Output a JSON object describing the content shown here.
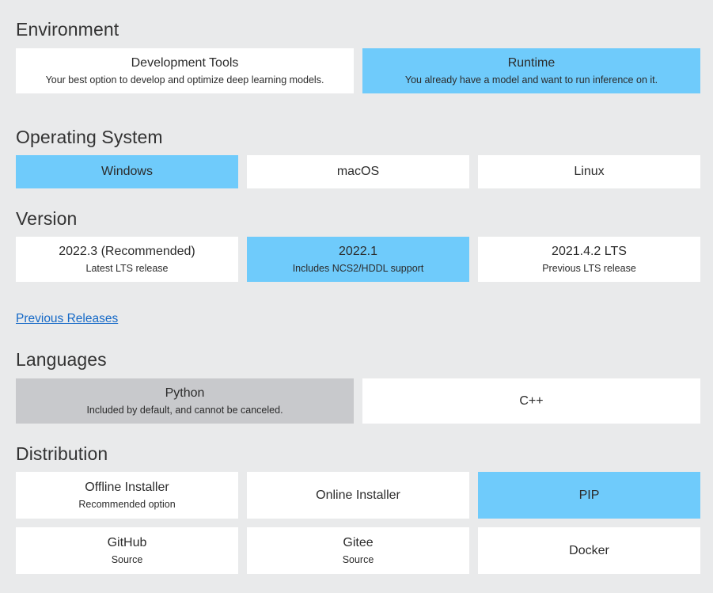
{
  "sections": {
    "environment": {
      "title": "Environment",
      "options": [
        {
          "title": "Development Tools",
          "subtitle": "Your best option to develop and optimize deep learning models.",
          "state": "default"
        },
        {
          "title": "Runtime",
          "subtitle": "You already have a model and want to run inference on it.",
          "state": "selected"
        }
      ]
    },
    "operating_system": {
      "title": "Operating System",
      "options": [
        {
          "title": "Windows",
          "subtitle": "",
          "state": "selected"
        },
        {
          "title": "macOS",
          "subtitle": "",
          "state": "default"
        },
        {
          "title": "Linux",
          "subtitle": "",
          "state": "default"
        }
      ]
    },
    "version": {
      "title": "Version",
      "options": [
        {
          "title": "2022.3 (Recommended)",
          "subtitle": "Latest LTS release",
          "state": "default"
        },
        {
          "title": "2022.1",
          "subtitle": "Includes NCS2/HDDL support",
          "state": "selected"
        },
        {
          "title": "2021.4.2 LTS",
          "subtitle": "Previous LTS release",
          "state": "default"
        }
      ],
      "previous_releases_link": "Previous Releases"
    },
    "languages": {
      "title": "Languages",
      "options": [
        {
          "title": "Python",
          "subtitle": "Included by default, and cannot be canceled.",
          "state": "disabled"
        },
        {
          "title": "C++",
          "subtitle": "",
          "state": "default"
        }
      ]
    },
    "distribution": {
      "title": "Distribution",
      "options": [
        {
          "title": "Offline Installer",
          "subtitle": "Recommended option",
          "state": "default"
        },
        {
          "title": "Online Installer",
          "subtitle": "",
          "state": "default"
        },
        {
          "title": "PIP",
          "subtitle": "",
          "state": "selected"
        },
        {
          "title": "GitHub",
          "subtitle": "Source",
          "state": "default"
        },
        {
          "title": "Gitee",
          "subtitle": "Source",
          "state": "default"
        },
        {
          "title": "Docker",
          "subtitle": "",
          "state": "default"
        }
      ]
    }
  },
  "colors": {
    "background": "#e9eaeb",
    "card_default": "#ffffff",
    "card_selected": "#6fcbfb",
    "card_disabled": "#c8c9cc",
    "link": "#1569c7",
    "heading": "#333333",
    "text": "#2b2b2b"
  }
}
